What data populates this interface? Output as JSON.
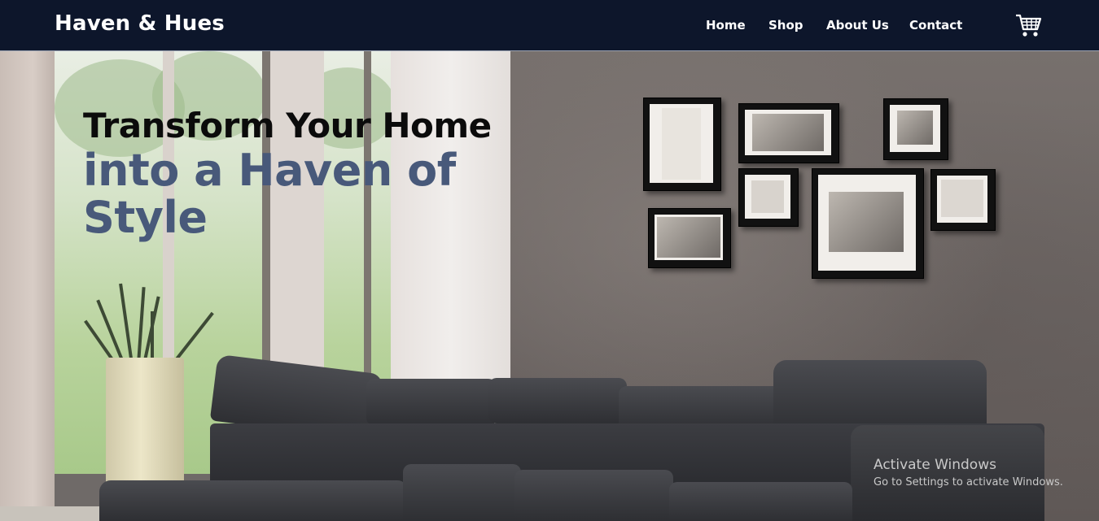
{
  "nav": {
    "brand": "Haven & Hues",
    "links": [
      "Home",
      "Shop",
      "About Us",
      "Contact"
    ],
    "cart_icon": "shopping-cart-icon"
  },
  "hero": {
    "headline_line1": "Transform Your Home",
    "headline_line2": "into a Haven of Style"
  },
  "system_watermark": {
    "title": "Activate Windows",
    "subtitle": "Go to Settings to activate Windows."
  },
  "colors": {
    "navbar": "#0d162b",
    "headline_dark": "#0b0b0b",
    "headline_accent": "#48597a"
  }
}
